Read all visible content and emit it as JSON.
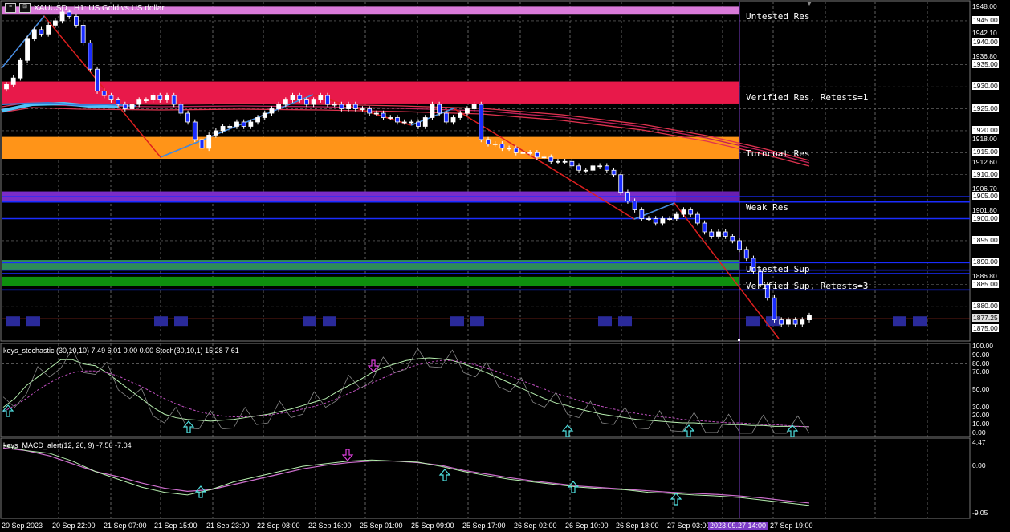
{
  "window": {
    "title": "XAUUSD., H1:  US Gold vs US dollar",
    "stoch_label": "keys_stochastic (30,10,10) 7.49 6.01 0.00 0.00 Stoch(30,10,1) 15.28 7.61",
    "macd_label": "keys_MACD_alert(12, 26, 9) -7.50 -7.04"
  },
  "zones": [
    {
      "label": "Untested Res",
      "color": "#d97ad9"
    },
    {
      "label": "Verified Res, Retests=1",
      "color": "#e8194a"
    },
    {
      "label": "Turncoat Res",
      "color": "#ff9418"
    },
    {
      "label": "Weak Res",
      "color": "#7a2cc8"
    },
    {
      "label": "Untested Sup",
      "color": "#2e8b57"
    },
    {
      "label": "Verified Sup, Retests=3",
      "color": "#0e8f0e"
    }
  ],
  "price_axis": [
    "1948.00",
    "1945.00",
    "1942.10",
    "1940.00",
    "1936.80",
    "1935.00",
    "1930.00",
    "1925.00",
    "1920.00",
    "1918.00",
    "1915.00",
    "1912.60",
    "1910.00",
    "1906.70",
    "1905.00",
    "1901.80",
    "1900.00",
    "1895.00",
    "1890.00",
    "1886.80",
    "1885.00",
    "1880.00",
    "1877.25",
    "1875.00"
  ],
  "stoch_axis": [
    "100.00",
    "90.00",
    "80.00",
    "70.00",
    "50.00",
    "30.00",
    "20.00",
    "10.00",
    "0.00"
  ],
  "macd_axis": [
    "4.47",
    "0.00",
    "-9.05"
  ],
  "time_axis": [
    "20 Sep 2023",
    "20 Sep 22:00",
    "21 Sep 07:00",
    "21 Sep 15:00",
    "21 Sep 23:00",
    "22 Sep 08:00",
    "22 Sep 16:00",
    "25 Sep 01:00",
    "25 Sep 09:00",
    "25 Sep 17:00",
    "26 Sep 02:00",
    "26 Sep 10:00",
    "26 Sep 18:00",
    "27 Sep 03:00",
    "2023.09.27 14:00",
    "27 Sep 19:00"
  ],
  "chart_data": {
    "type": "candlestick",
    "symbol": "XAUUSD.",
    "timeframe": "H1",
    "ylim": [
      1872,
      1949
    ],
    "last_price": 1877.25,
    "closes": [
      1930.5,
      1932,
      1936,
      1941,
      1943,
      1942,
      1944,
      1945,
      1947,
      1946,
      1944,
      1940,
      1934,
      1929,
      1928,
      1927,
      1926,
      1925,
      1926,
      1927,
      1927,
      1928,
      1927,
      1928,
      1926,
      1924,
      1922,
      1918,
      1916,
      1919,
      1920,
      1921,
      1921,
      1922,
      1921,
      1922,
      1923,
      1924,
      1925,
      1926,
      1927,
      1928,
      1927,
      1926,
      1927,
      1928,
      1926,
      1926,
      1925,
      1926,
      1925,
      1925,
      1924,
      1924,
      1923,
      1923,
      1922,
      1922,
      1922,
      1921,
      1923,
      1926,
      1924,
      1922,
      1923,
      1924,
      1925,
      1926,
      1918,
      1917,
      1917,
      1916,
      1916,
      1915,
      1915,
      1915,
      1914,
      1914,
      1913,
      1913,
      1913,
      1912,
      1911,
      1911,
      1912,
      1912,
      1911,
      1910,
      1906,
      1904,
      1902,
      1900,
      1900,
      1899,
      1900,
      1900,
      1901,
      1902,
      1901,
      1899,
      1897,
      1896,
      1897,
      1896,
      1895,
      1893,
      1891,
      1888,
      1885,
      1882,
      1877,
      1876,
      1877,
      1876,
      1877,
      1878
    ],
    "stoch_main": [
      30,
      40,
      55,
      65,
      75,
      85,
      85,
      80,
      78,
      70,
      60,
      50,
      40,
      30,
      22,
      18,
      16,
      15,
      14,
      15,
      16,
      18,
      20,
      22,
      25,
      28,
      32,
      36,
      40,
      48,
      55,
      62,
      70,
      76,
      80,
      84,
      86,
      87,
      86,
      84,
      80,
      75,
      70,
      64,
      58,
      52,
      46,
      40,
      35,
      32,
      28,
      25,
      22,
      20,
      18,
      16,
      15,
      14,
      13,
      12,
      12,
      11,
      11,
      10,
      10,
      9,
      9,
      8,
      8,
      8,
      7.5
    ],
    "stoch_signal": [
      25,
      32,
      40,
      50,
      58,
      65,
      70,
      72,
      72,
      70,
      66,
      60,
      54,
      47,
      40,
      34,
      29,
      25,
      22,
      20,
      19,
      19,
      20,
      21,
      23,
      25,
      28,
      31,
      35,
      40,
      46,
      52,
      58,
      64,
      70,
      75,
      79,
      82,
      84,
      84,
      82,
      79,
      75,
      71,
      66,
      61,
      56,
      51,
      46,
      42,
      38,
      34,
      31,
      28,
      25,
      23,
      21,
      19,
      18,
      16,
      15,
      14,
      13,
      12,
      12,
      11,
      10,
      10,
      9,
      8,
      7.6
    ],
    "macd_main": [
      4,
      3,
      2.5,
      1,
      -1,
      -2.5,
      -4,
      -5,
      -5.5,
      -4.5,
      -3,
      -2,
      -1,
      0,
      0.5,
      1,
      1.2,
      1,
      0.8,
      0,
      -1,
      -1.8,
      -2.5,
      -3,
      -3.5,
      -4,
      -4.3,
      -4.5,
      -5,
      -5.2,
      -5.5,
      -5.7,
      -6,
      -6.5,
      -7,
      -7.5
    ],
    "macd_signal": [
      3.5,
      3,
      2,
      0.5,
      -1,
      -2,
      -3.2,
      -4.2,
      -4.8,
      -4.5,
      -3.5,
      -2.5,
      -1.5,
      -0.5,
      0.2,
      0.7,
      1,
      1,
      0.7,
      0.2,
      -0.8,
      -1.5,
      -2.2,
      -2.8,
      -3.3,
      -3.8,
      -4.1,
      -4.4,
      -4.7,
      -5,
      -5.2,
      -5.4,
      -5.7,
      -6.1,
      -6.6,
      -7.04
    ]
  }
}
